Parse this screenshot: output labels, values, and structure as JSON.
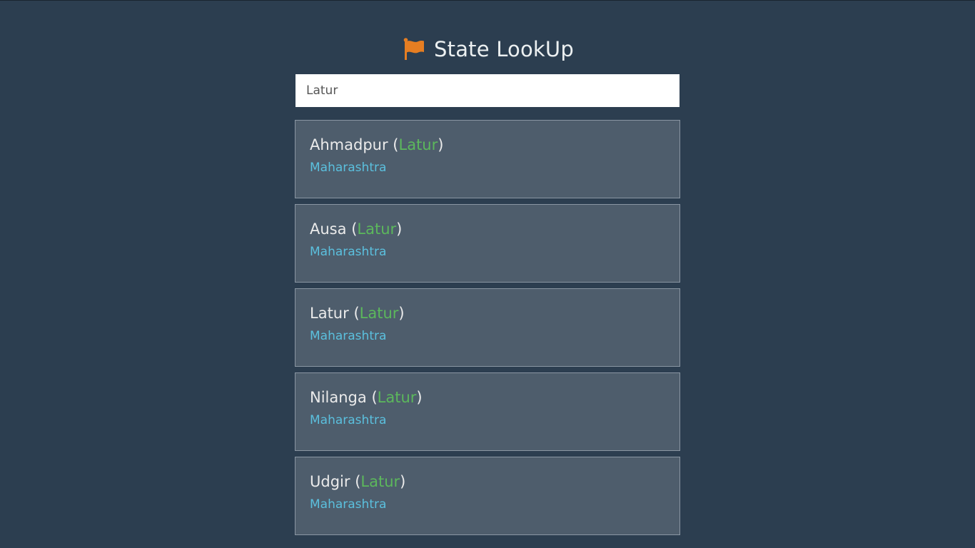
{
  "app": {
    "title": "State LookUp",
    "icon": "flag-icon",
    "colors": {
      "background": "#2c3e50",
      "card": "#4e5d6c",
      "flag": "#e67e22",
      "district": "#5cb85c",
      "state": "#5bc0de"
    }
  },
  "search": {
    "value": "Latur",
    "placeholder": ""
  },
  "results": [
    {
      "city": "Ahmadpur",
      "open": "(",
      "district": "Latur",
      "close": ")",
      "state": "Maharashtra"
    },
    {
      "city": "Ausa",
      "open": "(",
      "district": "Latur",
      "close": ")",
      "state": "Maharashtra"
    },
    {
      "city": "Latur",
      "open": "(",
      "district": "Latur",
      "close": ")",
      "state": "Maharashtra"
    },
    {
      "city": "Nilanga",
      "open": "(",
      "district": "Latur",
      "close": ")",
      "state": "Maharashtra"
    },
    {
      "city": "Udgir",
      "open": "(",
      "district": "Latur",
      "close": ")",
      "state": "Maharashtra"
    }
  ]
}
